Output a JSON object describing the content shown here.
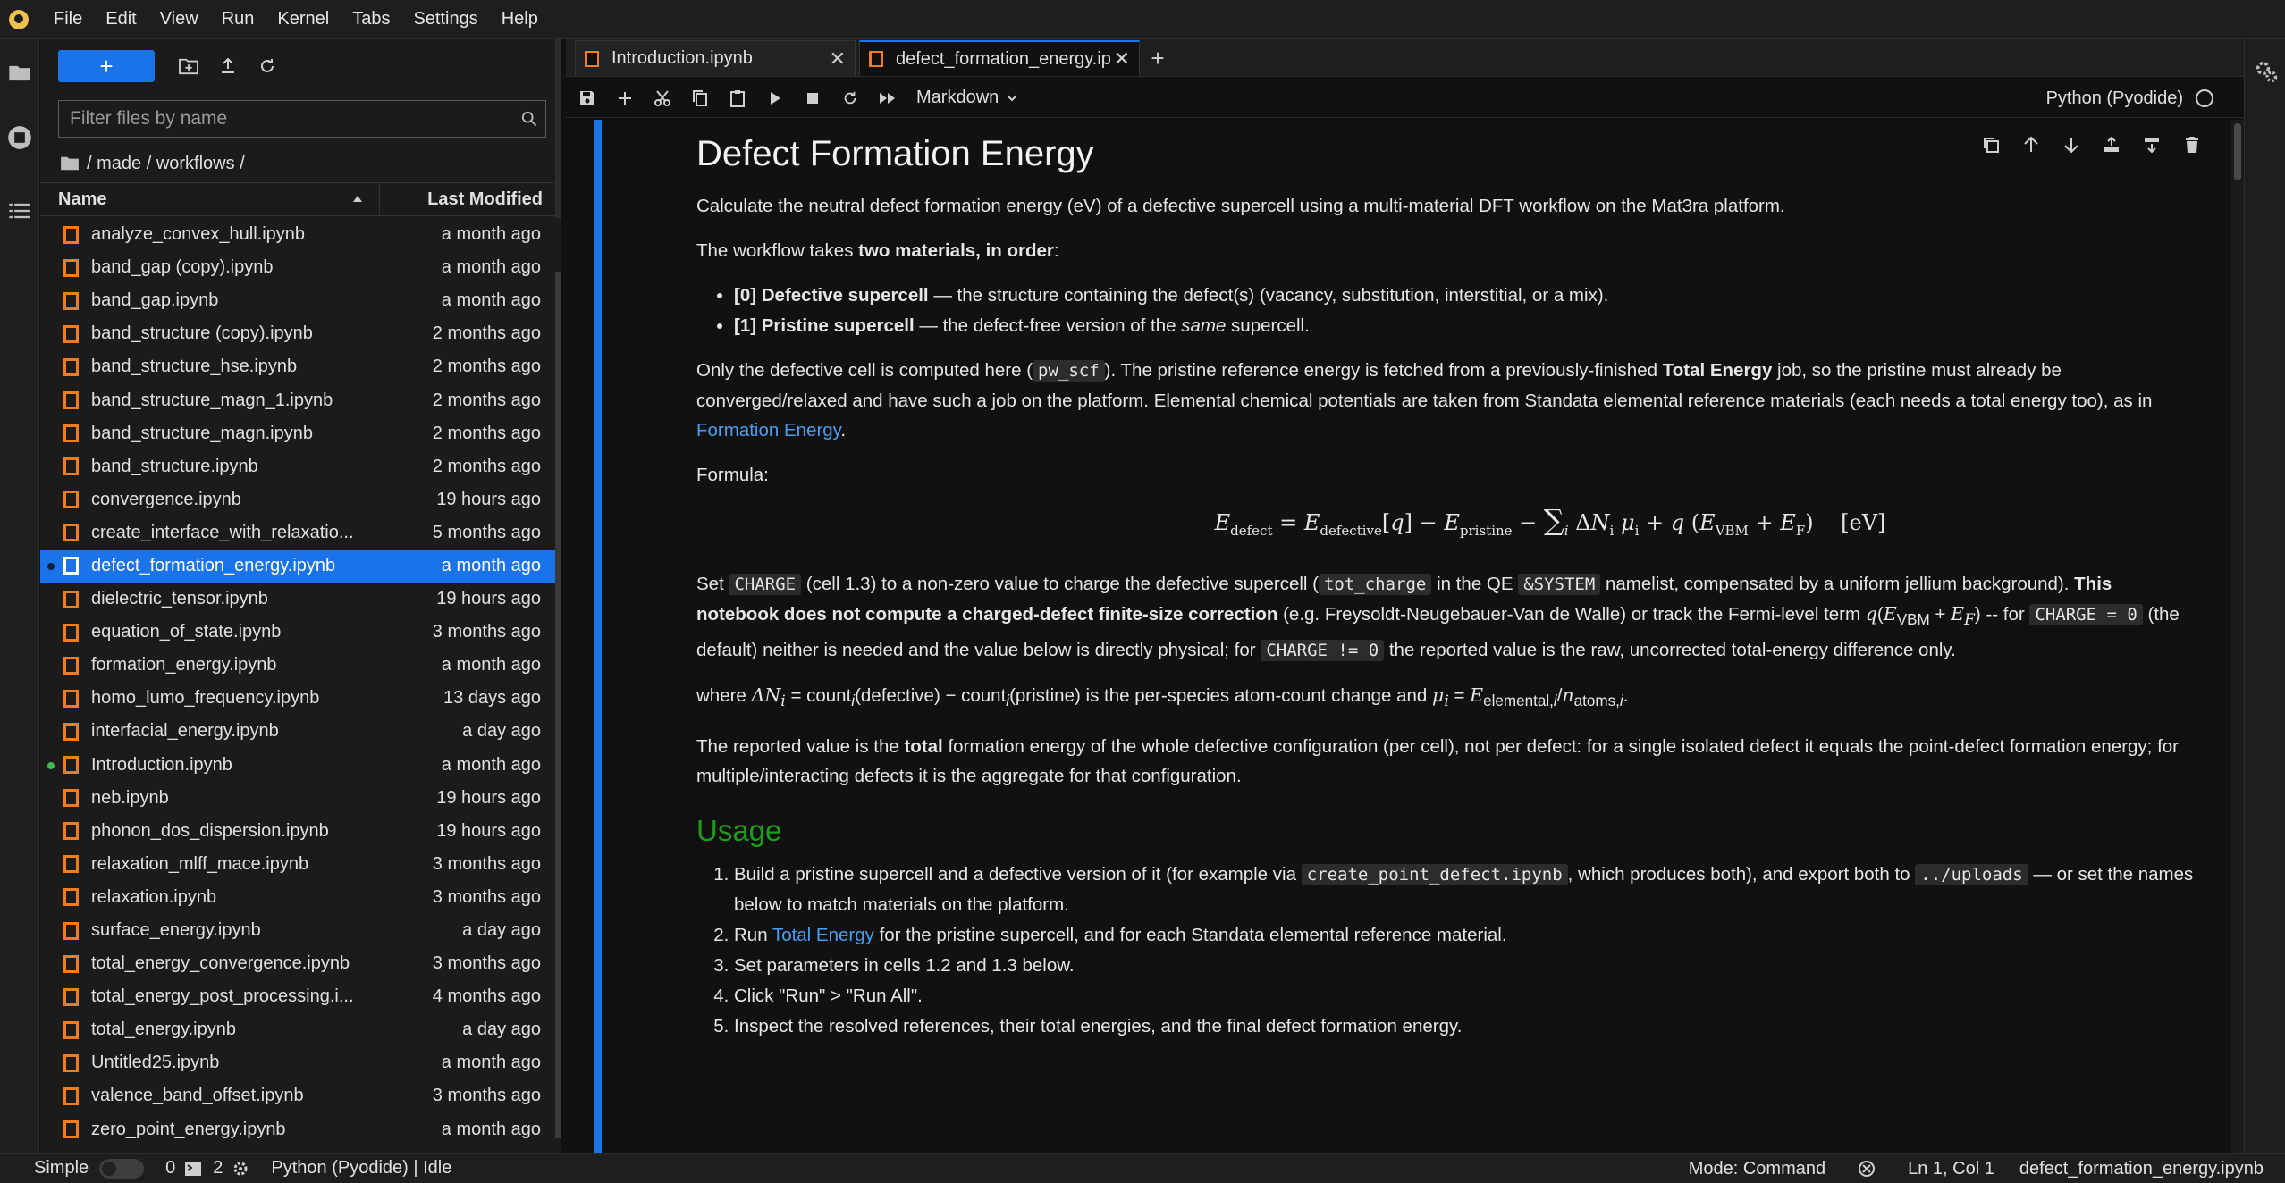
{
  "menu": [
    "File",
    "Edit",
    "View",
    "Run",
    "Kernel",
    "Tabs",
    "Settings",
    "Help"
  ],
  "filebrowser": {
    "new_label": "+",
    "filter_placeholder": "Filter files by name",
    "breadcrumb": "/ made / workflows /",
    "col_name": "Name",
    "col_modified": "Last Modified",
    "files": [
      {
        "name": "analyze_convex_hull.ipynb",
        "modified": "a month ago",
        "selected": false,
        "dot": ""
      },
      {
        "name": "band_gap (copy).ipynb",
        "modified": "a month ago",
        "selected": false,
        "dot": ""
      },
      {
        "name": "band_gap.ipynb",
        "modified": "a month ago",
        "selected": false,
        "dot": ""
      },
      {
        "name": "band_structure (copy).ipynb",
        "modified": "2 months ago",
        "selected": false,
        "dot": ""
      },
      {
        "name": "band_structure_hse.ipynb",
        "modified": "2 months ago",
        "selected": false,
        "dot": ""
      },
      {
        "name": "band_structure_magn_1.ipynb",
        "modified": "2 months ago",
        "selected": false,
        "dot": ""
      },
      {
        "name": "band_structure_magn.ipynb",
        "modified": "2 months ago",
        "selected": false,
        "dot": ""
      },
      {
        "name": "band_structure.ipynb",
        "modified": "2 months ago",
        "selected": false,
        "dot": ""
      },
      {
        "name": "convergence.ipynb",
        "modified": "19 hours ago",
        "selected": false,
        "dot": ""
      },
      {
        "name": "create_interface_with_relaxatio...",
        "modified": "5 months ago",
        "selected": false,
        "dot": ""
      },
      {
        "name": "defect_formation_energy.ipynb",
        "modified": "a month ago",
        "selected": true,
        "dot": "#0b1e3b"
      },
      {
        "name": "dielectric_tensor.ipynb",
        "modified": "19 hours ago",
        "selected": false,
        "dot": ""
      },
      {
        "name": "equation_of_state.ipynb",
        "modified": "3 months ago",
        "selected": false,
        "dot": ""
      },
      {
        "name": "formation_energy.ipynb",
        "modified": "a month ago",
        "selected": false,
        "dot": ""
      },
      {
        "name": "homo_lumo_frequency.ipynb",
        "modified": "13 days ago",
        "selected": false,
        "dot": ""
      },
      {
        "name": "interfacial_energy.ipynb",
        "modified": "a day ago",
        "selected": false,
        "dot": ""
      },
      {
        "name": "Introduction.ipynb",
        "modified": "a month ago",
        "selected": false,
        "dot": "#3fb950"
      },
      {
        "name": "neb.ipynb",
        "modified": "19 hours ago",
        "selected": false,
        "dot": ""
      },
      {
        "name": "phonon_dos_dispersion.ipynb",
        "modified": "19 hours ago",
        "selected": false,
        "dot": ""
      },
      {
        "name": "relaxation_mlff_mace.ipynb",
        "modified": "3 months ago",
        "selected": false,
        "dot": ""
      },
      {
        "name": "relaxation.ipynb",
        "modified": "3 months ago",
        "selected": false,
        "dot": ""
      },
      {
        "name": "surface_energy.ipynb",
        "modified": "a day ago",
        "selected": false,
        "dot": ""
      },
      {
        "name": "total_energy_convergence.ipynb",
        "modified": "3 months ago",
        "selected": false,
        "dot": ""
      },
      {
        "name": "total_energy_post_processing.i...",
        "modified": "4 months ago",
        "selected": false,
        "dot": ""
      },
      {
        "name": "total_energy.ipynb",
        "modified": "a day ago",
        "selected": false,
        "dot": ""
      },
      {
        "name": "Untitled25.ipynb",
        "modified": "a month ago",
        "selected": false,
        "dot": ""
      },
      {
        "name": "valence_band_offset.ipynb",
        "modified": "3 months ago",
        "selected": false,
        "dot": ""
      },
      {
        "name": "zero_point_energy.ipynb",
        "modified": "a month ago",
        "selected": false,
        "dot": ""
      }
    ]
  },
  "tabs": [
    {
      "label": "Introduction.ipynb",
      "active": false
    },
    {
      "label": "defect_formation_energy.ip",
      "active": true
    }
  ],
  "toolbar": {
    "cell_type": "Markdown",
    "kernel": "Python (Pyodide)"
  },
  "notebook": {
    "title": "Defect Formation Energy",
    "p1": "Calculate the neutral defect formation energy (eV) of a defective supercell using a multi-material DFT workflow on the Mat3ra platform.",
    "p2_a": "The workflow takes ",
    "p2_b": "two materials, in order",
    "p2_c": ":",
    "li1_a": "[0] Defective supercell",
    "li1_b": " — the structure containing the defect(s) (vacancy, substitution, interstitial, or a mix).",
    "li2_a": "[1] Pristine supercell",
    "li2_b": " — the defect-free version of the ",
    "li2_c": "same",
    "li2_d": " supercell.",
    "p3_a": "Only the defective cell is computed here (",
    "p3_code": "pw_scf",
    "p3_b": "). The pristine reference energy is fetched from a previously-finished ",
    "p3_c": "Total Energy",
    "p3_d": " job, so the pristine must already be converged/relaxed and have such a job on the platform. Elemental chemical potentials are taken from Standata elemental reference materials (each needs a total energy too), as in ",
    "p3_link": "Formation Energy",
    "p3_e": ".",
    "formula_label": "Formula:",
    "p4_a": "Set ",
    "p4_code1": "CHARGE",
    "p4_b": " (cell 1.3) to a non-zero value to charge the defective supercell (",
    "p4_code2": "tot_charge",
    "p4_c": " in the QE ",
    "p4_code3": "&SYSTEM",
    "p4_d": " namelist, compensated by a uniform jellium background). ",
    "p4_bold": "This notebook does not compute a charged-defect finite-size correction",
    "p4_e": " (e.g. Freysoldt-Neugebauer-Van de Walle) or track the Fermi-level term ",
    "p4_f": " -- for ",
    "p4_code4": "CHARGE = 0",
    "p4_g": " (the default) neither is needed and the value below is directly physical; for ",
    "p4_code5": "CHARGE != 0",
    "p4_h": " the reported value is the raw, uncorrected total-energy difference only.",
    "p5_a": "where ",
    "p5_b": " is the per-species atom-count change and ",
    "p5_c": ".",
    "p6_a": "The reported value is the ",
    "p6_b": "total",
    "p6_c": " formation energy of the whole defective configuration (per cell), not per defect: for a single isolated defect it equals the point-defect formation energy; for multiple/interacting defects it is the aggregate for that configuration.",
    "usage_title": "Usage",
    "u1_a": "Build a pristine supercell and a defective version of it (for example via ",
    "u1_code1": "create_point_defect.ipynb",
    "u1_b": ", which produces both), and export both to ",
    "u1_code2": "../uploads",
    "u1_c": " — or set the names below to match materials on the platform.",
    "u2_a": "Run ",
    "u2_link": "Total Energy",
    "u2_b": " for the pristine supercell, and for each Standata elemental reference material.",
    "u3": "Set parameters in cells 1.2 and 1.3 below.",
    "u4": "Click \"Run\" > \"Run All\".",
    "u5": "Inspect the resolved references, their total energies, and the final defect formation energy."
  },
  "statusbar": {
    "simple": "Simple",
    "terminals": "0",
    "kernels": "2",
    "kernel_status": "Python (Pyodide) | Idle",
    "mode": "Mode: Command",
    "position": "Ln 1, Col 1",
    "file": "defect_formation_energy.ipynb"
  },
  "colors": {
    "accent": "#1a73e8",
    "heading_green": "#1e9c1e",
    "link": "#4a9df0",
    "notebook_icon": "#f07c1b"
  }
}
